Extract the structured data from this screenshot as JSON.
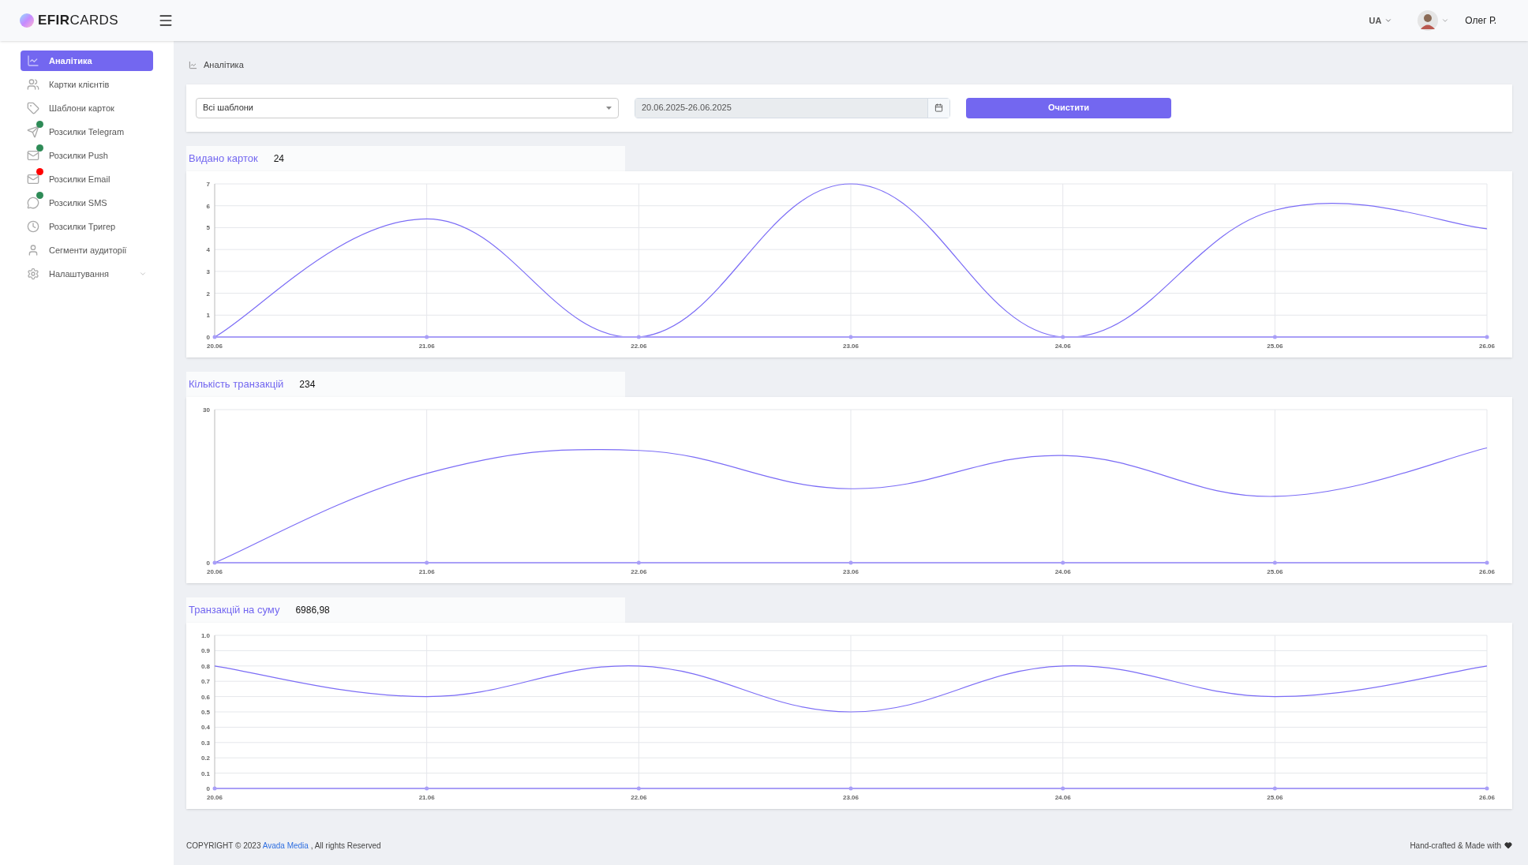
{
  "header": {
    "logo": {
      "bold": "EFIR",
      "light": "CARDS"
    },
    "language": "UA",
    "user_name": "Олег Р."
  },
  "sidebar": {
    "items": [
      {
        "label": "Аналітика",
        "selected": true,
        "kind": "link"
      },
      {
        "label": "Картки клієнтів",
        "selected": false,
        "kind": "link"
      },
      {
        "label": "Шаблони карток",
        "selected": false,
        "kind": "link"
      },
      {
        "label": "Розсилки Telegram",
        "selected": false,
        "kind": "link",
        "color": "#2e8b57"
      },
      {
        "label": "Розсилки Push",
        "selected": false,
        "kind": "link",
        "color": "#2e8b57"
      },
      {
        "label": "Розсилки Email",
        "selected": false,
        "kind": "link",
        "color": "#ff0000"
      },
      {
        "label": "Розсилки SMS",
        "selected": false,
        "kind": "link",
        "color": "#2e8b57"
      },
      {
        "label": "Розсилки Тригер",
        "selected": false,
        "kind": "link"
      },
      {
        "label": "Сегменти аудиторії",
        "selected": false,
        "kind": "link"
      },
      {
        "label": "Налаштування",
        "selected": false,
        "kind": "group"
      }
    ]
  },
  "breadcrumb": "Аналітика",
  "filters": {
    "template_select": {
      "value": "Всі шаблони"
    },
    "date_range": {
      "value": "20.06.2025-26.06.2025"
    },
    "clear_button": "Очистити"
  },
  "charts": [
    {
      "title": "Видано карток",
      "total": "24",
      "chart_data": {
        "type": "line",
        "grid": true,
        "categories": [
          "20.06",
          "21.06",
          "22.06",
          "23.06",
          "24.06",
          "25.06",
          "26.06"
        ],
        "ylim": [
          0,
          7
        ],
        "yticks": [
          0,
          1,
          2,
          3,
          4,
          5,
          6,
          7
        ],
        "series": [
          {
            "color": "#7b6cf6",
            "values": [
              0,
              5.4,
              0,
              7,
              0,
              5.8,
              4.95
            ]
          },
          {
            "color": "#a99ff7",
            "values": [
              0,
              0,
              0,
              0,
              0,
              0,
              0
            ]
          }
        ]
      }
    },
    {
      "title": "Кількість транзакцій",
      "total": "234",
      "chart_data": {
        "type": "line",
        "grid": true,
        "categories": [
          "20.06",
          "21.06",
          "22.06",
          "23.06",
          "24.06",
          "25.06",
          "26.06"
        ],
        "ylim": [
          0,
          30
        ],
        "yticks": [
          0,
          30
        ],
        "series": [
          {
            "color": "#7b6cf6",
            "values": [
              0,
              17.5,
              22,
              14.5,
              21,
              13,
              22.5
            ]
          },
          {
            "color": "#a99ff7",
            "values": [
              0,
              0,
              0,
              0,
              0,
              0,
              0
            ]
          }
        ]
      }
    },
    {
      "title": "Транзакцій на суму",
      "total": "6986,98",
      "chart_data": {
        "type": "line",
        "grid": true,
        "categories": [
          "20.06",
          "21.06",
          "22.06",
          "23.06",
          "24.06",
          "25.06",
          "26.06"
        ],
        "ylim": [
          0,
          1
        ],
        "yticks": [
          0,
          0.1,
          0.2,
          0.3,
          0.4,
          0.5,
          0.6,
          0.7,
          0.8,
          0.9,
          {
            "value": 1,
            "label": "1.0"
          }
        ],
        "series": [
          {
            "color": "#7b6cf6",
            "values": [
              0.8,
              0.6,
              0.8,
              0.5,
              0.8,
              0.6,
              0.8
            ]
          },
          {
            "color": "#a99ff7",
            "values": [
              0,
              0,
              0,
              0,
              0,
              0,
              0
            ]
          }
        ]
      }
    }
  ],
  "footer": {
    "copyright": "COPYRIGHT © 2023",
    "link": "Avada Media",
    "rights": ", All rights Reserved",
    "credit": "Hand-crafted & Made with"
  }
}
